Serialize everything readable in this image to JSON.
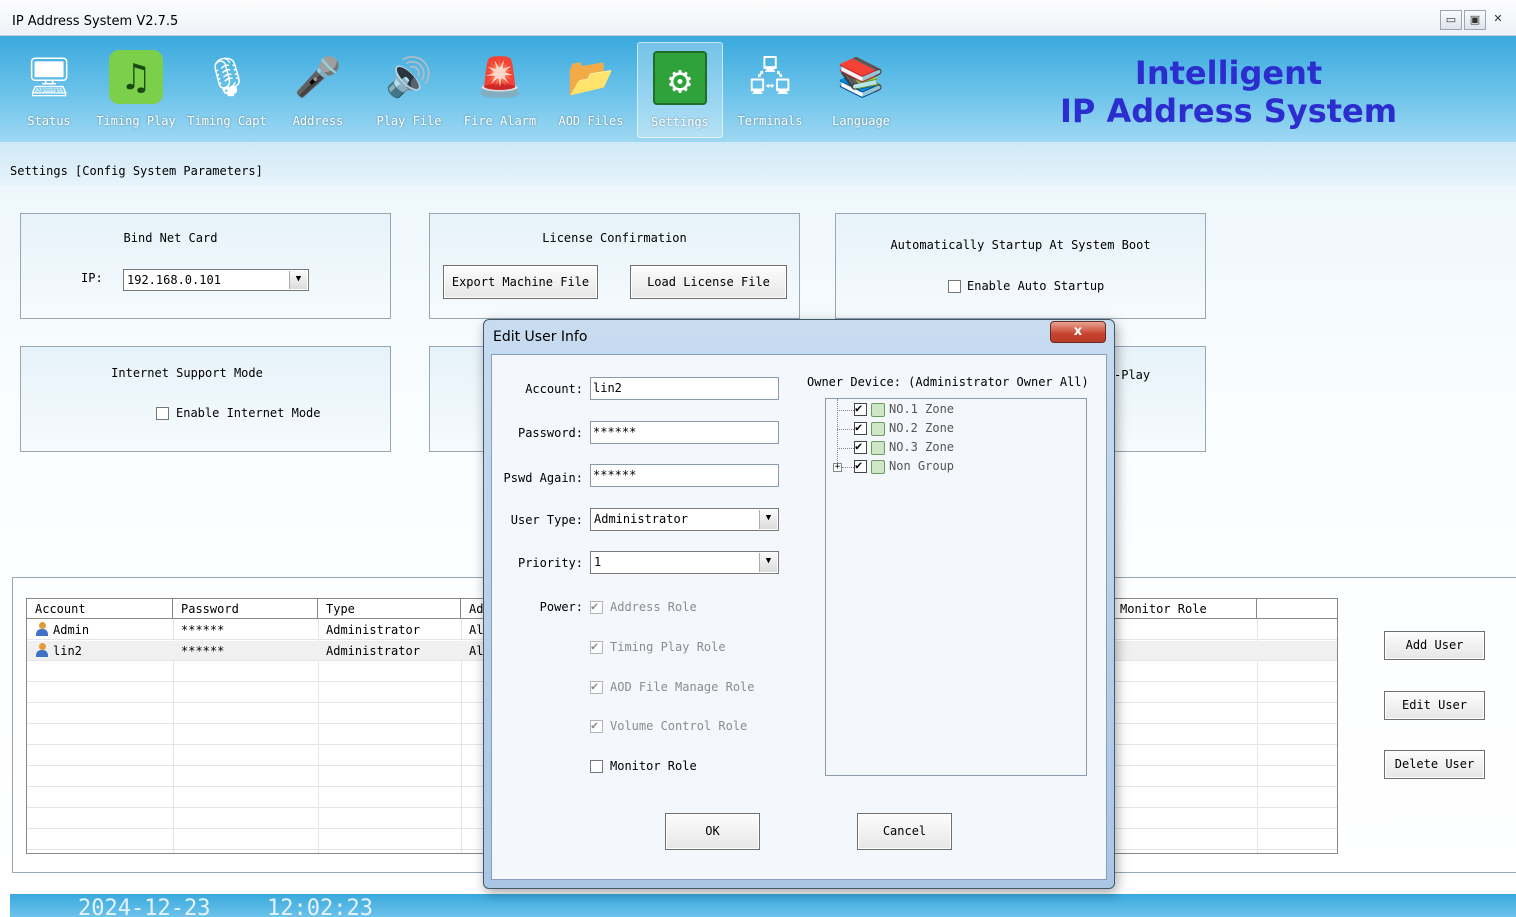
{
  "window": {
    "title": "IP Address System V2.7.5",
    "buttons": [
      "▭",
      "▣",
      "✕"
    ]
  },
  "toolbar": {
    "items": [
      {
        "label": "Status",
        "icon": "status-monitor-icon",
        "glyph": "🖥"
      },
      {
        "label": "Timing Play",
        "icon": "music-note-icon",
        "glyph": "♫"
      },
      {
        "label": "Timing Capt",
        "icon": "microphone-icon",
        "glyph": "🎙"
      },
      {
        "label": "Address",
        "icon": "mic-waveform-icon",
        "glyph": "🎤"
      },
      {
        "label": "Play File",
        "icon": "speaker-icon",
        "glyph": "🔊"
      },
      {
        "label": "Fire Alarm",
        "icon": "alarm-light-icon",
        "glyph": "🚨"
      },
      {
        "label": "AOD Files",
        "icon": "folder-icon",
        "glyph": "📂"
      },
      {
        "label": "Settings",
        "icon": "settings-icon",
        "glyph": "⚙"
      },
      {
        "label": "Terminals",
        "icon": "terminals-icon",
        "glyph": "🖧"
      },
      {
        "label": "Language",
        "icon": "books-icon",
        "glyph": "📚"
      }
    ],
    "active": "Settings",
    "brand_line1": "Intelligent",
    "brand_line2": "IP Address System"
  },
  "breadcrumb": "Settings [Config System Parameters]",
  "settings": {
    "bind_net_card": {
      "title": "Bind Net Card",
      "ip_label": "IP:",
      "ip_value": "192.168.0.101"
    },
    "license": {
      "title": "License Confirmation",
      "export_label": "Export Machine File",
      "load_label": "Load License File"
    },
    "auto_startup": {
      "title": "Automatically Startup At System Boot",
      "checkbox_label": "Enable Auto Startup",
      "checked": false
    },
    "internet": {
      "title": "Internet Support Mode",
      "checkbox_label": "Enable Internet Mode",
      "checked": false
    },
    "partial_group_text": "-Play"
  },
  "users_table": {
    "columns": [
      "Account",
      "Password",
      "Type",
      "Ad",
      "Monitor Role"
    ],
    "rows": [
      {
        "account": "Admin",
        "password": "******",
        "type": "Administrator",
        "ad": "Al"
      },
      {
        "account": "lin2",
        "password": "******",
        "type": "Administrator",
        "ad": "Al"
      }
    ]
  },
  "user_buttons": {
    "add": "Add User",
    "edit": "Edit User",
    "delete": "Delete User"
  },
  "statusbar": {
    "date": "2024-12-23",
    "time": "12:02:23"
  },
  "dialog": {
    "title": "Edit User Info",
    "close": "x",
    "account_label": "Account:",
    "account_value": "lin2",
    "password_label": "Password:",
    "password_value": "******",
    "pswd_again_label": "Pswd Again:",
    "pswd_again_value": "******",
    "user_type_label": "User Type:",
    "user_type_value": "Administrator",
    "priority_label": "Priority:",
    "priority_value": "1",
    "power_label": "Power:",
    "roles": [
      {
        "label": "Address Role",
        "checked": true,
        "disabled": true
      },
      {
        "label": "Timing Play Role",
        "checked": true,
        "disabled": true
      },
      {
        "label": "AOD File Manage Role",
        "checked": true,
        "disabled": true
      },
      {
        "label": "Volume Control Role",
        "checked": true,
        "disabled": true
      },
      {
        "label": "Monitor Role",
        "checked": false,
        "disabled": false
      }
    ],
    "owner_device_label": "Owner Device: (Administrator Owner All)",
    "devices": [
      {
        "label": "NO.1 Zone",
        "checked": true
      },
      {
        "label": "NO.2 Zone",
        "checked": true
      },
      {
        "label": "NO.3 Zone",
        "checked": true
      },
      {
        "label": "Non Group",
        "checked": true,
        "expandable": true
      }
    ],
    "ok_label": "OK",
    "cancel_label": "Cancel"
  }
}
